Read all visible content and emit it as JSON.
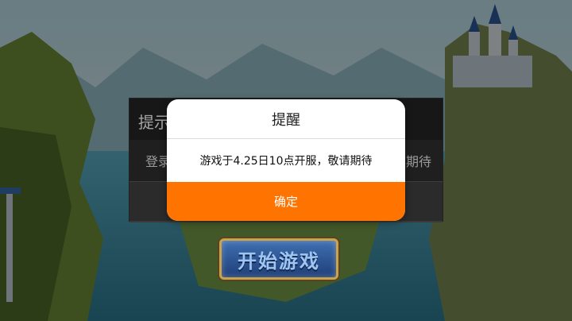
{
  "background": {
    "start_button_label": "开始游戏"
  },
  "back_dialog": {
    "title": "提示",
    "message_left": "登录",
    "message_right": "期待"
  },
  "alert": {
    "title": "提醒",
    "message": "游戏于4.25日10点开服，敬请期待",
    "confirm_label": "确定"
  },
  "colors": {
    "accent": "#ff7400",
    "dialog_bg": "#ffffff"
  }
}
